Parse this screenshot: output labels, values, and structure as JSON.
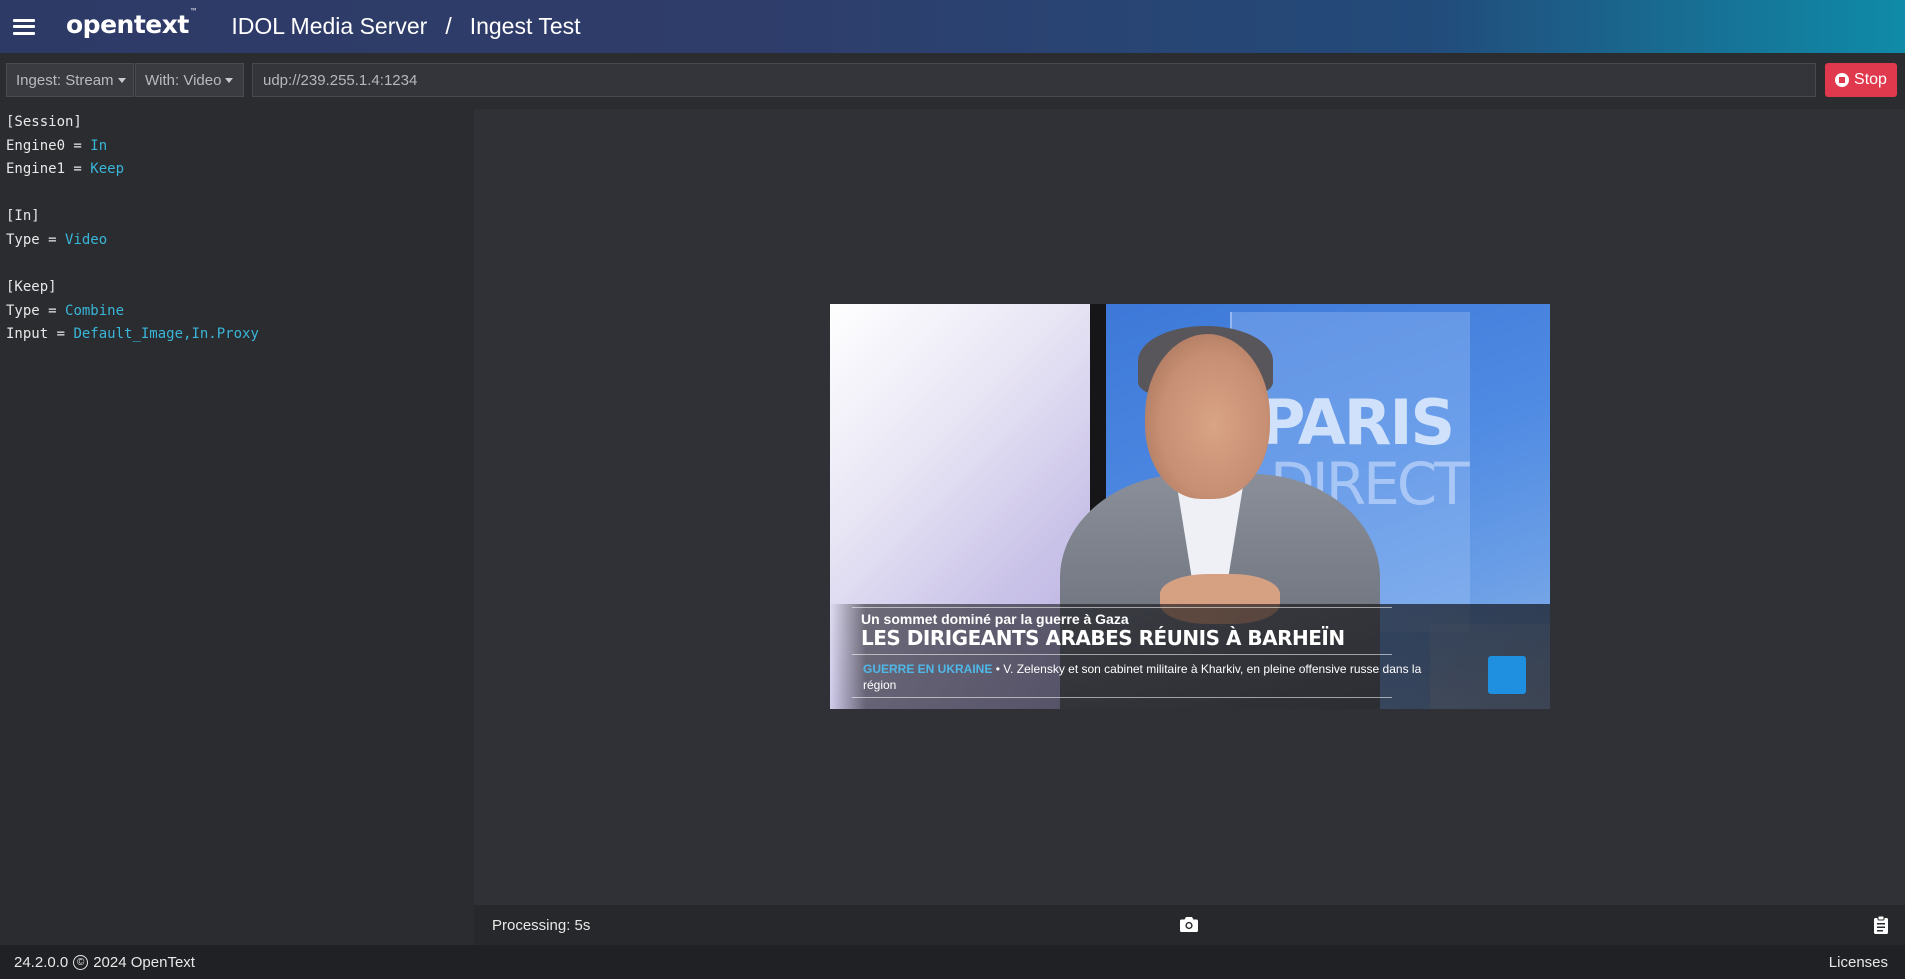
{
  "header": {
    "menu_icon": "hamburger-icon",
    "logo_text": "opentext",
    "logo_tm": "™",
    "app_name": "IDOL Media Server",
    "separator": "/",
    "page_title": "Ingest Test"
  },
  "toolbar": {
    "ingest_dropdown": "Ingest: Stream",
    "with_dropdown": "With: Video",
    "url_value": "udp://239.255.1.4:1234",
    "stop_label": "Stop",
    "stop_icon": "stop-circle-icon",
    "stop_color": "#e0394e"
  },
  "config": {
    "lines": [
      {
        "key": "[Session]",
        "value": ""
      },
      {
        "key": "Engine0 = ",
        "value": "In"
      },
      {
        "key": "Engine1 = ",
        "value": "Keep"
      },
      {
        "key": "",
        "value": ""
      },
      {
        "key": "[In]",
        "value": ""
      },
      {
        "key": "Type = ",
        "value": "Video"
      },
      {
        "key": "",
        "value": ""
      },
      {
        "key": "[Keep]",
        "value": ""
      },
      {
        "key": "Type = ",
        "value": "Combine"
      },
      {
        "key": "Input = ",
        "value": "Default_Image,In.Proxy"
      }
    ],
    "value_color": "#39b6d8"
  },
  "video": {
    "background_text_1": "PARIS",
    "background_text_2": "DIRECT",
    "lower_third_subtitle": "Un sommet dominé par la guerre à Gaza",
    "lower_third_title": "LES DIRIGEANTS ARABES RÉUNIS À BARHEÏN",
    "ticker_tag": "GUERRE EN UKRAINE",
    "ticker_text": " • V. Zelensky et son cabinet militaire à Kharkiv, en pleine offensive russe dans la région",
    "channel_logo": "france24-logo"
  },
  "status": {
    "processing": "Processing: 5s",
    "snapshot_icon": "camera-icon",
    "clipboard_icon": "clipboard-icon"
  },
  "footer": {
    "version": "24.2.0.0",
    "copyright_symbol": "©",
    "copyright_text": "2024 OpenText",
    "licenses": "Licenses"
  }
}
